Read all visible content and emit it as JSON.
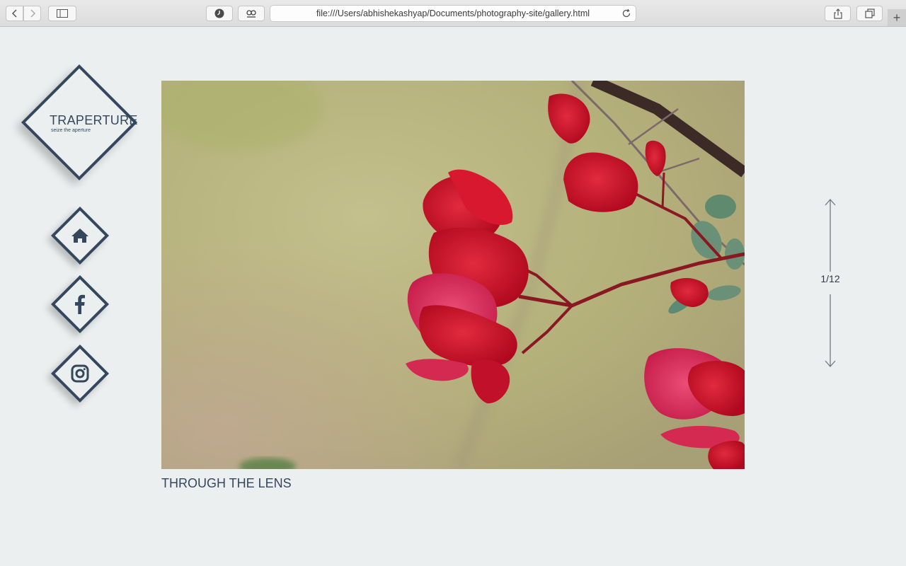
{
  "browser": {
    "url": "file:///Users/abhishekashyap/Documents/photography-site/gallery.html",
    "new_tab": "+"
  },
  "logo": {
    "title": "TRAPERTURE",
    "tagline": "seize the aperture"
  },
  "nav": [
    {
      "name": "home",
      "icon": "home-icon"
    },
    {
      "name": "facebook",
      "icon": "facebook-icon"
    },
    {
      "name": "instagram",
      "icon": "instagram-icon"
    }
  ],
  "gallery": {
    "caption": "THROUGH THE LENS",
    "counter": "1/12",
    "current": 1,
    "total": 12
  },
  "colors": {
    "brand": "#34475c",
    "background": "#ebeff0",
    "flower": "#c8102e"
  }
}
